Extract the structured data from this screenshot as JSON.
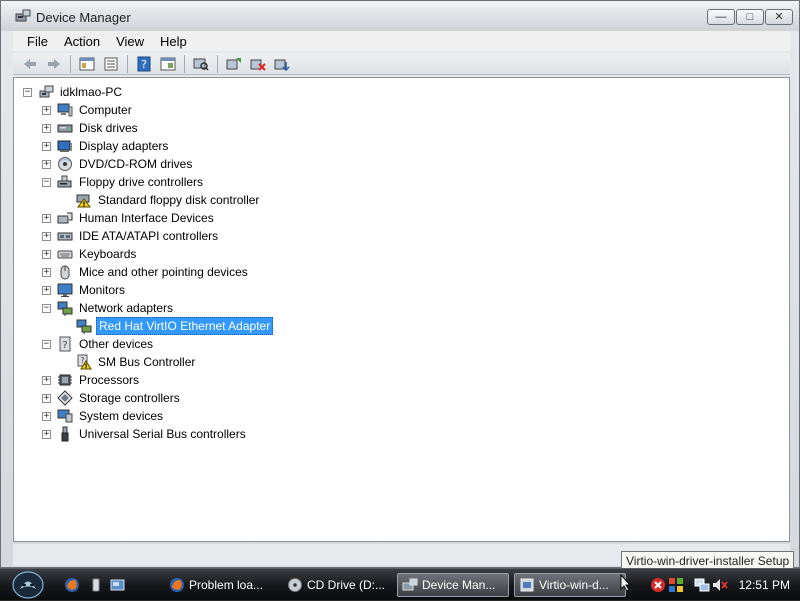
{
  "window": {
    "title": "Device Manager",
    "buttons": {
      "minimize": "—",
      "maximize": "□",
      "close": "✕"
    }
  },
  "menu": [
    "File",
    "Action",
    "View",
    "Help"
  ],
  "toolbar": {
    "buttons": [
      "back-icon",
      "forward-icon",
      "properties-pane-icon",
      "properties-icon",
      "help-icon",
      "view-icon",
      "scan-hardware-icon",
      "update-driver-icon",
      "uninstall-icon",
      "disable-icon"
    ]
  },
  "tree": {
    "root": "idklmao-PC",
    "items": [
      {
        "label": "Computer",
        "expander": "+",
        "icon": "computer-icon"
      },
      {
        "label": "Disk drives",
        "expander": "+",
        "icon": "disk-drive-icon"
      },
      {
        "label": "Display adapters",
        "expander": "+",
        "icon": "display-adapter-icon"
      },
      {
        "label": "DVD/CD-ROM drives",
        "expander": "+",
        "icon": "dvd-drive-icon"
      },
      {
        "label": "Floppy drive controllers",
        "expander": "-",
        "icon": "floppy-controller-icon"
      },
      {
        "label": "Standard floppy disk controller",
        "child": true,
        "icon": "floppy-warning-icon"
      },
      {
        "label": "Human Interface Devices",
        "expander": "+",
        "icon": "hid-icon"
      },
      {
        "label": "IDE ATA/ATAPI controllers",
        "expander": "+",
        "icon": "ide-controller-icon"
      },
      {
        "label": "Keyboards",
        "expander": "+",
        "icon": "keyboard-icon"
      },
      {
        "label": "Mice and other pointing devices",
        "expander": "+",
        "icon": "mouse-icon"
      },
      {
        "label": "Monitors",
        "expander": "+",
        "icon": "monitor-icon"
      },
      {
        "label": "Network adapters",
        "expander": "-",
        "icon": "network-adapter-icon"
      },
      {
        "label": "Red Hat VirtIO Ethernet Adapter",
        "child": true,
        "selected": true,
        "icon": "network-adapter-icon"
      },
      {
        "label": "Other devices",
        "expander": "-",
        "icon": "other-devices-icon"
      },
      {
        "label": "SM Bus Controller",
        "child": true,
        "icon": "unknown-device-warning-icon"
      },
      {
        "label": "Processors",
        "expander": "+",
        "icon": "processor-icon"
      },
      {
        "label": "Storage controllers",
        "expander": "+",
        "icon": "storage-controller-icon"
      },
      {
        "label": "System devices",
        "expander": "+",
        "icon": "system-devices-icon"
      },
      {
        "label": "Universal Serial Bus controllers",
        "expander": "+",
        "icon": "usb-icon"
      }
    ]
  },
  "tooltip": "Virtio-win-driver-installer Setup",
  "taskbar": {
    "tasks": [
      {
        "label": "Problem loa...",
        "icon": "firefox-icon"
      },
      {
        "label": "CD Drive (D:...",
        "icon": "cd-drive-icon"
      },
      {
        "label": "Device Man...",
        "icon": "device-manager-icon",
        "active": true
      },
      {
        "label": "Virtio-win-d...",
        "icon": "installer-icon",
        "active": true
      }
    ],
    "clock": "12:51 PM"
  }
}
